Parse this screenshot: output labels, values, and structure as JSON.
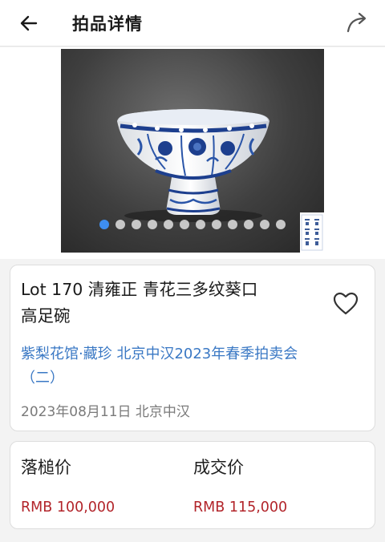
{
  "header": {
    "title": "拍品详情",
    "back_icon": "arrow-left-icon",
    "share_icon": "share-arrow-icon"
  },
  "gallery": {
    "image": "blue-and-white-stem-bowl",
    "seal_text": [
      "大",
      "明",
      "宣",
      "德",
      "年",
      "製"
    ],
    "slide_count": 12,
    "active_index": 0,
    "active_color": "#3e8ef0"
  },
  "lot": {
    "title_line1": "Lot 170 清雍正 青花三多纹葵口",
    "title_line2": "高足碗",
    "auction_line1": "紫梨花馆·藏珍 北京中汉2023年春季拍卖会",
    "auction_line2": "（二）",
    "meta": "2023年08月11日 北京中汉",
    "favorite_icon": "heart-outline-icon"
  },
  "prices": {
    "hammer_label": "落槌价",
    "hammer_value": "RMB 100,000",
    "final_label": "成交价",
    "final_value": "RMB 115,000",
    "price_color": "#b2242a"
  }
}
